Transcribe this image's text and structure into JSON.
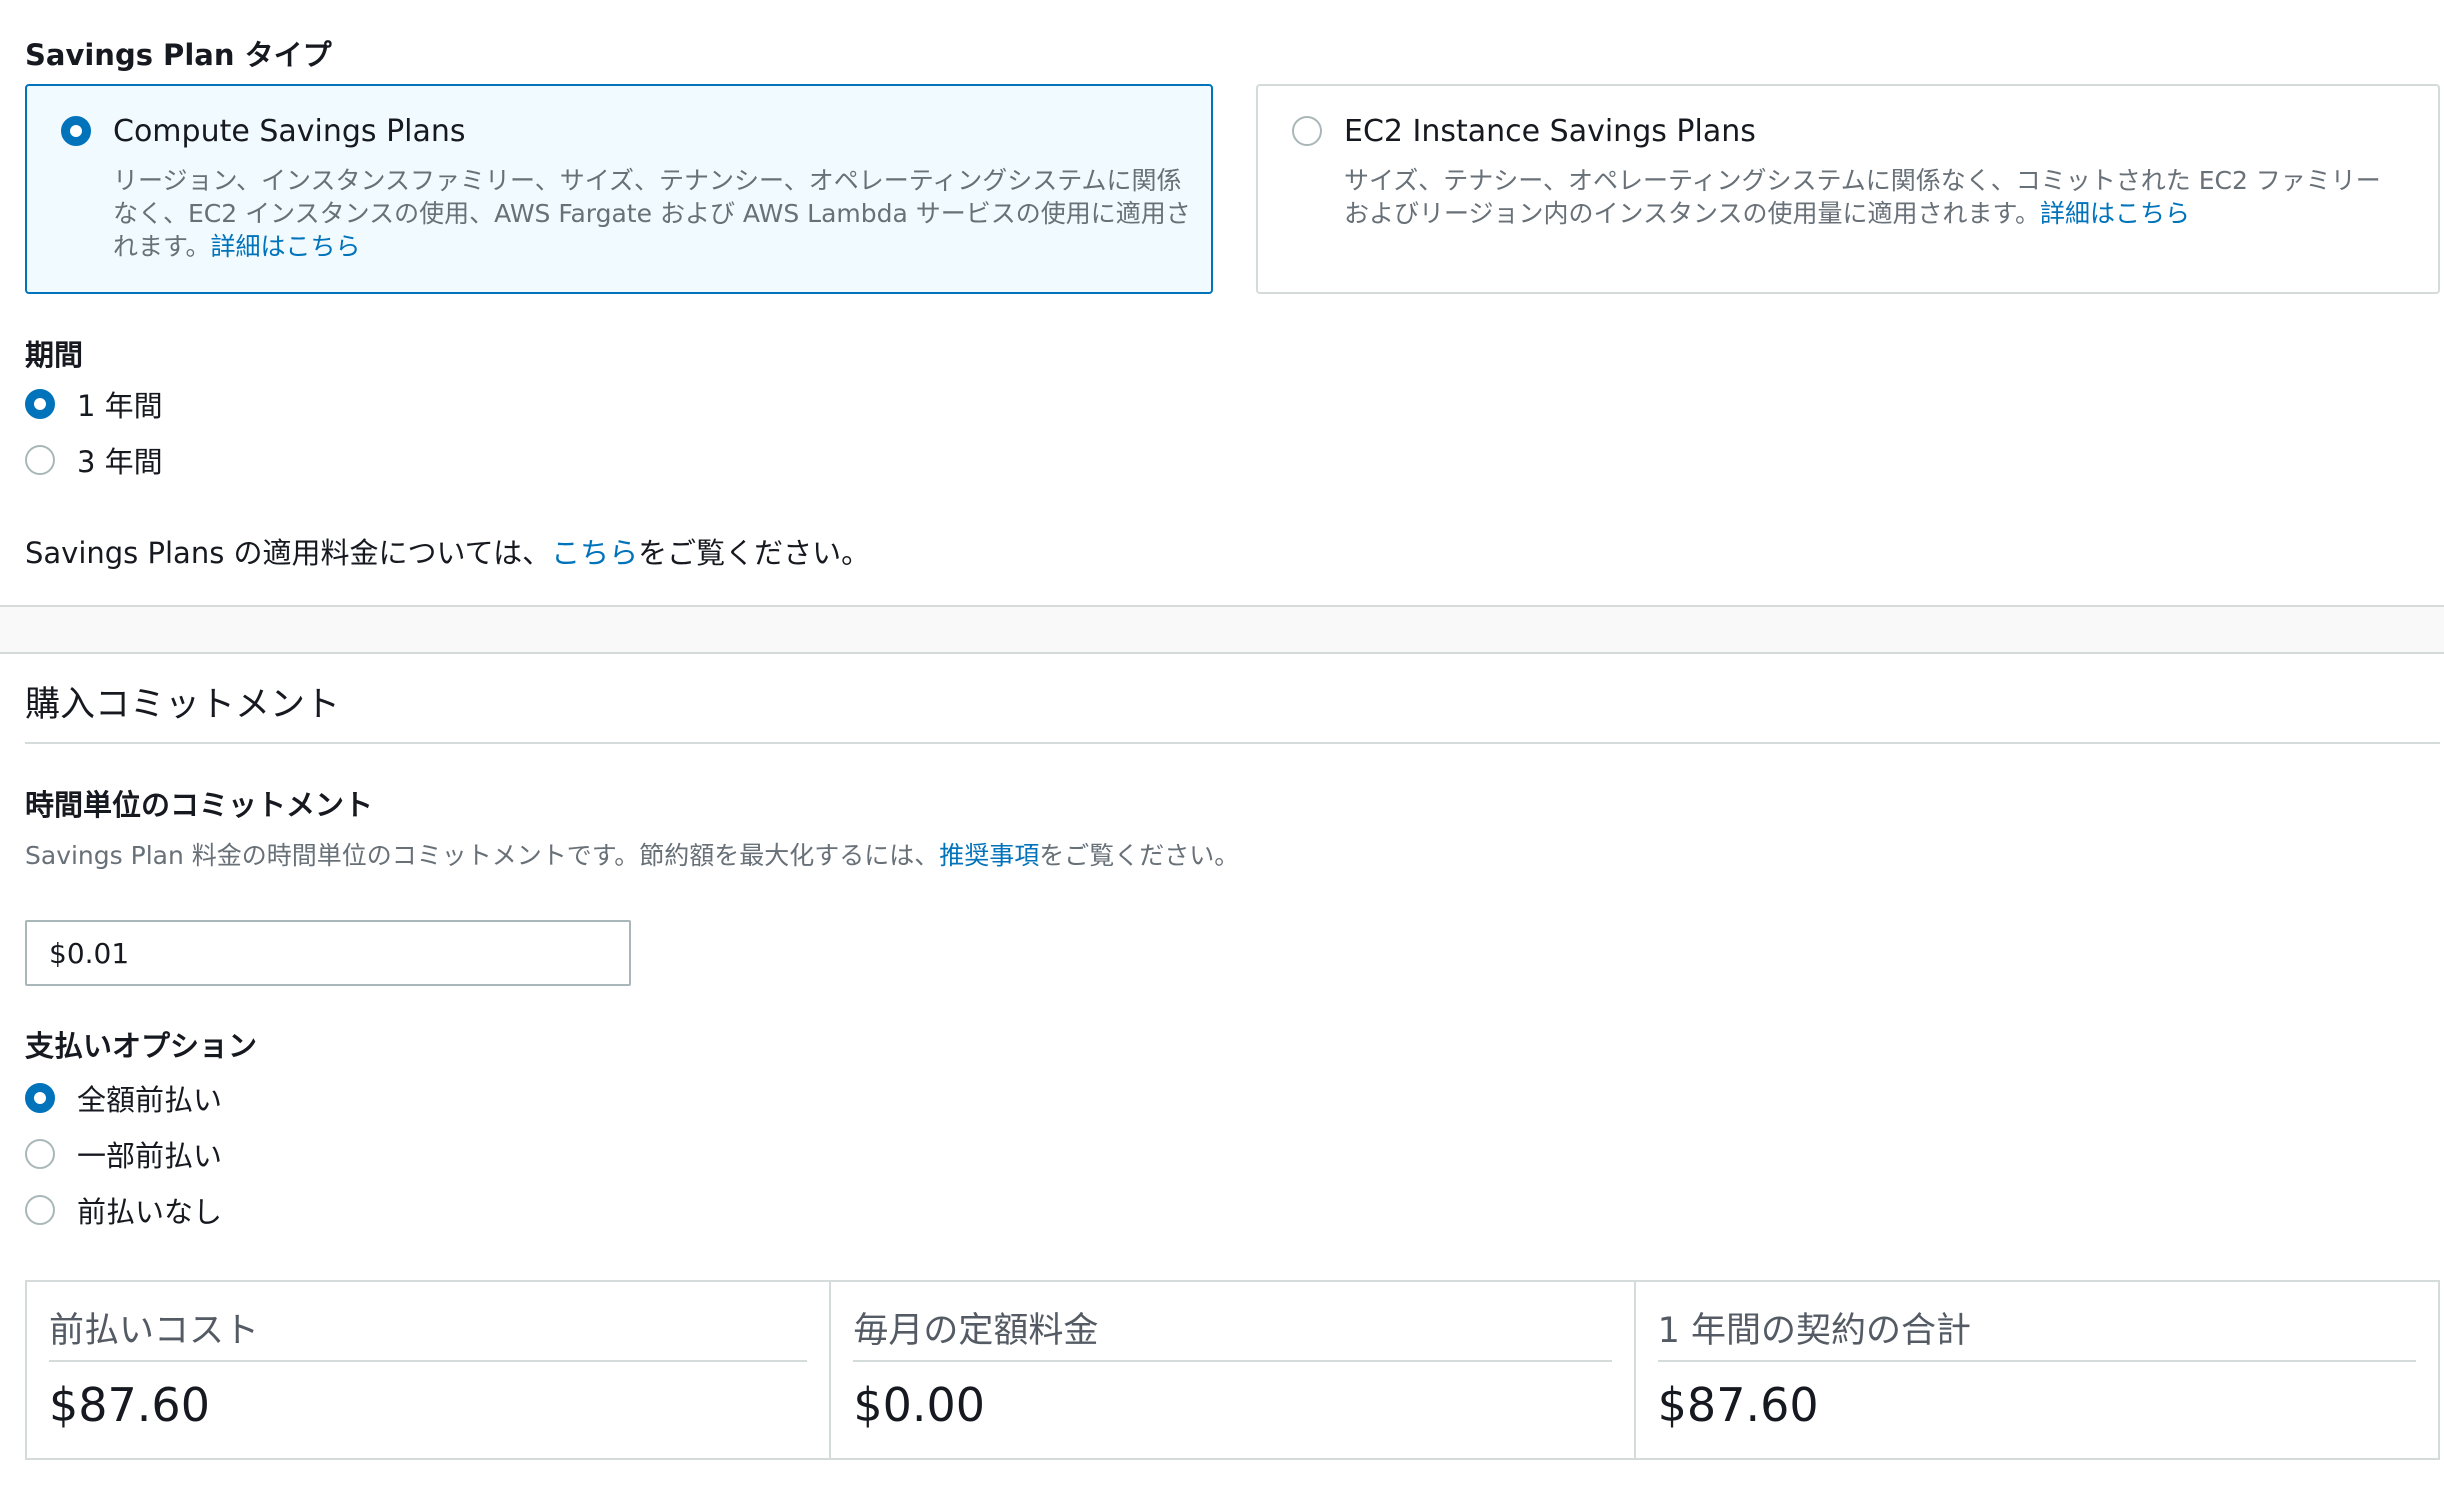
{
  "plan_type": {
    "label": "Savings Plan タイプ",
    "options": [
      {
        "title": "Compute Savings Plans",
        "description": "リージョン、インスタンスファミリー、サイズ、テナンシー、オペレーティングシステムに関係なく、EC2 インスタンスの使用、AWS Fargate および AWS Lambda サービスの使用に適用されます。",
        "link": "詳細はこちら",
        "selected": true
      },
      {
        "title": "EC2 Instance Savings Plans",
        "description": "サイズ、テナシー、オペレーティングシステムに関係なく、コミットされた EC2 ファミリーおよびリージョン内のインスタンスの使用量に適用されます。",
        "link": "詳細はこちら",
        "selected": false
      }
    ]
  },
  "term": {
    "label": "期間",
    "options": [
      {
        "label": "1 年間",
        "selected": true
      },
      {
        "label": "3 年間",
        "selected": false
      }
    ]
  },
  "pricing_info": {
    "prefix": "Savings Plans の適用料金については、",
    "link": "こちら",
    "suffix": "をご覧ください。"
  },
  "commitment": {
    "section_title": "購入コミットメント",
    "hourly_label": "時間単位のコミットメント",
    "hourly_desc_prefix": "Savings Plan 料金の時間単位のコミットメントです。節約額を最大化するには、",
    "hourly_desc_link": "推奨事項",
    "hourly_desc_suffix": "をご覧ください。",
    "hourly_value": "$0.01"
  },
  "payment": {
    "label": "支払いオプション",
    "options": [
      {
        "label": "全額前払い",
        "selected": true
      },
      {
        "label": "一部前払い",
        "selected": false
      },
      {
        "label": "前払いなし",
        "selected": false
      }
    ]
  },
  "summary": [
    {
      "title": "前払いコスト",
      "value": "$87.60"
    },
    {
      "title": "毎月の定額料金",
      "value": "$0.00"
    },
    {
      "title": "1 年間の契約の合計",
      "value": "$87.60"
    }
  ],
  "colors": {
    "accent": "#0073bb",
    "selected_card_bg": "#f1faff",
    "border": "#d5dbdb",
    "secondary_text": "#687078"
  }
}
